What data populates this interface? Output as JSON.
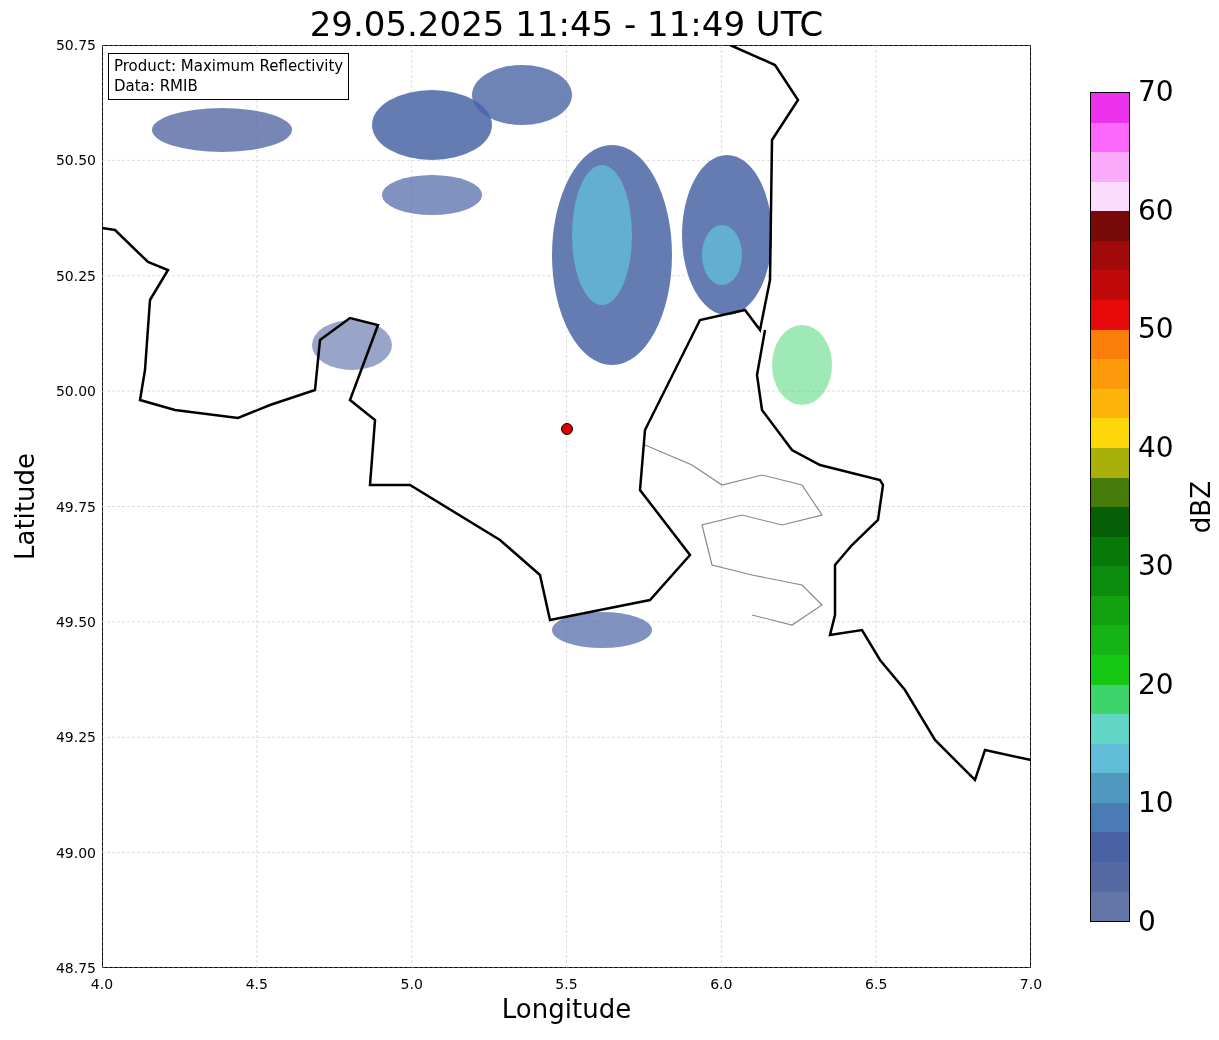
{
  "title": "29.05.2025 11:45 - 11:49 UTC",
  "info_box": {
    "lines": [
      "Product: Maximum Reflectivity",
      "Data: RMIB"
    ]
  },
  "map": {
    "xlabel": "Longitude",
    "ylabel": "Latitude",
    "xticks": [
      "4.0",
      "4.5",
      "5.0",
      "5.5",
      "6.0",
      "6.5",
      "7.0"
    ],
    "yticks": [
      "50.75",
      "50.50",
      "50.25",
      "50.00",
      "49.75",
      "49.50",
      "49.25",
      "49.00",
      "48.75"
    ]
  },
  "colorbar": {
    "label": "dBZ",
    "ticks": [
      "70",
      "60",
      "50",
      "40",
      "30",
      "20",
      "10",
      "0"
    ],
    "segments": [
      {
        "color": "#ec32ec"
      },
      {
        "color": "#fc68fc"
      },
      {
        "color": "#fcaafc"
      },
      {
        "color": "#fcdcfc"
      },
      {
        "color": "#780a0a"
      },
      {
        "color": "#a00a0a"
      },
      {
        "color": "#c00a0a"
      },
      {
        "color": "#e80a0a"
      },
      {
        "color": "#fc7e0a"
      },
      {
        "color": "#fc9a0a"
      },
      {
        "color": "#fcb40a"
      },
      {
        "color": "#fcd80a"
      },
      {
        "color": "#aab00a"
      },
      {
        "color": "#467a0a"
      },
      {
        "color": "#065f06"
      },
      {
        "color": "#087808"
      },
      {
        "color": "#0c8c0c"
      },
      {
        "color": "#10a010"
      },
      {
        "color": "#14b414"
      },
      {
        "color": "#14c814"
      },
      {
        "color": "#3dd46b"
      },
      {
        "color": "#62d6c6"
      },
      {
        "color": "#61bcd8"
      },
      {
        "color": "#4f98c0"
      },
      {
        "color": "#4a7bb4"
      },
      {
        "color": "#4a62a3"
      },
      {
        "color": "#5569a3"
      },
      {
        "color": "#6475a8"
      }
    ]
  }
}
